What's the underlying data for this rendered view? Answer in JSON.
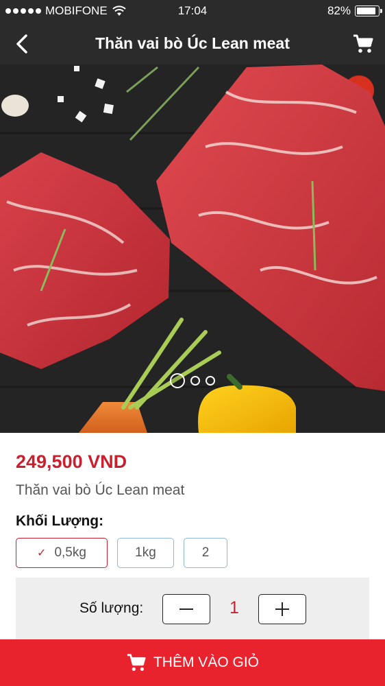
{
  "status_bar": {
    "carrier": "MOBIFONE",
    "time": "17:04",
    "battery": "82%",
    "battery_level": 0.82,
    "signal_bars": 5
  },
  "header": {
    "title": "Thăn vai bò Úc Lean meat",
    "back_icon": "back-chevron-icon",
    "cart_icon": "cart-icon"
  },
  "gallery": {
    "image_count": 3,
    "active_index": 0
  },
  "product": {
    "price": "249,500 VND",
    "name": "Thăn vai bò Úc Lean meat",
    "weight_label": "Khối Lượng:",
    "weight_options": [
      {
        "label": "0,5kg",
        "selected": true
      },
      {
        "label": "1kg",
        "selected": false
      },
      {
        "label": "2",
        "selected": false
      }
    ]
  },
  "quantity": {
    "label": "Số lượng:",
    "value": "1",
    "minus_label": "−",
    "plus_label": "+"
  },
  "add_to_cart": {
    "label": "THÊM VÀO GIỎ"
  },
  "colors": {
    "accent_red": "#e8232d",
    "price_red": "#c8202f",
    "header_bg": "#2b2b2b",
    "option_border": "#8fb8d8"
  }
}
